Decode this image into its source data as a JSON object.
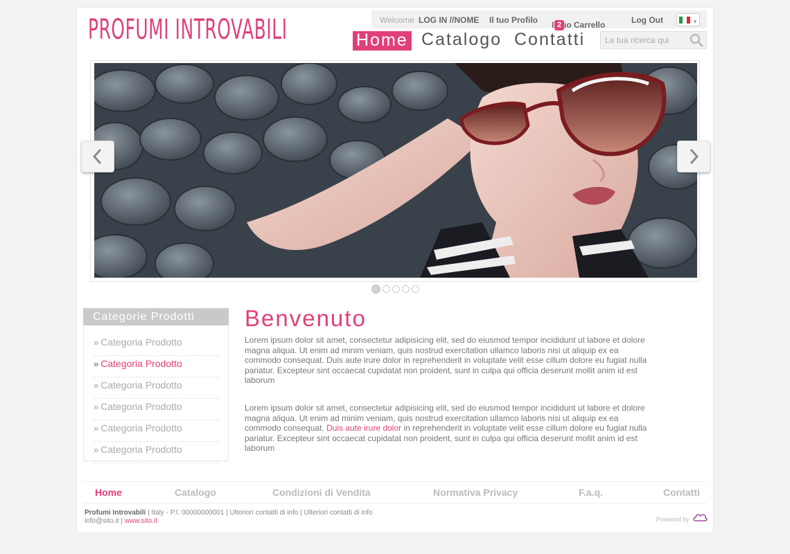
{
  "brand": {
    "logo_text": "PROFUMI INTROVABILI",
    "accent_color": "#e0407a"
  },
  "topbar": {
    "welcome": "Welcome",
    "login": "LOG IN //NOME",
    "profile": "Il tuo Profilo",
    "cart": "Il tuo Carrello",
    "cart_count": "2",
    "logout": "Log Out",
    "language_flag": "italy-flag-icon"
  },
  "nav": {
    "home": "Home",
    "catalog": "Catalogo",
    "contacts": "Contatti"
  },
  "search": {
    "placeholder": "La tua ricerca qui"
  },
  "slider": {
    "slide_count": 5,
    "active_slide": 1
  },
  "sidebar": {
    "title": "Categorie Prodotti",
    "items": [
      {
        "label": "Categoria Prodotto",
        "active": false
      },
      {
        "label": "Categoria Prodotto",
        "active": true
      },
      {
        "label": "Categoria Prodotto",
        "active": false
      },
      {
        "label": "Categoria Prodotto",
        "active": false
      },
      {
        "label": "Categoria Prodotto",
        "active": false
      },
      {
        "label": "Categoria Prodotto",
        "active": false
      }
    ]
  },
  "content": {
    "title": "Benvenuto",
    "paragraph1": "Lorem ipsum dolor sit amet, consectetur adipisicing elit, sed do eiusmod tempor incididunt ut labore et dolore magna aliqua. Ut enim ad minim veniam, quis nostrud exercitation ullamco laboris nisi ut aliquip ex ea commodo consequat. Duis aute irure dolor in reprehenderit in voluptate velit esse cillum dolore eu fugiat nulla pariatur. Excepteur sint occaecat cupidatat non proident, sunt in culpa qui officia deserunt mollit anim id est laborum",
    "paragraph2_before": "Lorem ipsum dolor sit amet, consectetur adipisicing elit, sed do eiusmod tempor incididunt ut labore et dolore magna aliqua. Ut enim ad minim veniam, quis nostrud exercitation ullamco laboris nisi ut aliquip ex ea commodo consequat.",
    "paragraph2_link": "Duis aute irure dolor",
    "paragraph2_after": "in reprehenderit in voluptate velit esse cillum dolore eu fugiat nulla pariatur. Excepteur sint occaecat cupidatat non proident, sunt in culpa qui officia deserunt mollit anim id est laborum"
  },
  "footer": {
    "nav": [
      "Home",
      "Catalogo",
      "Condizioni di Vendita",
      "Normativa Privacy",
      "F.a.q.",
      "Contatti"
    ],
    "company": "Profumi Introvabili",
    "info_line1": "| Italy - P.I. 00000000001 | Ulteriori contatti di info | Ulteriori contatti di info",
    "email": "info@sito.it |",
    "site": "www.sito.it",
    "powered_by": "Powered by"
  }
}
